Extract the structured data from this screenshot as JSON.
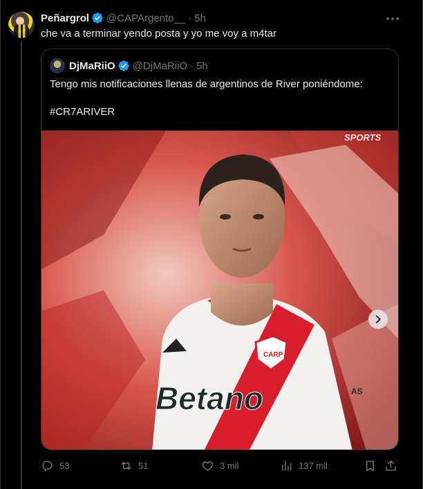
{
  "tweet": {
    "author_name": "Peñargrol",
    "handle": "@CAPArgento__",
    "separator": "·",
    "time": "5h",
    "text": "che va a terminar yendo posta y yo me voy a m4tar"
  },
  "quote": {
    "author_name": "DjMaRiiO",
    "handle": "@DjMaRiiO",
    "separator": "·",
    "time": "5h",
    "text": "Tengo mis notificaciones llenas de argentinos de River poniéndome:",
    "hashtag": "#CR7ARIVER",
    "image": {
      "watermark": "SPORTS",
      "sponsor": "Betano",
      "shirt_logo_text": "CARP",
      "sleeve_text": "AS"
    }
  },
  "actions": {
    "replies": "53",
    "reposts": "51",
    "likes": "3 mil",
    "views": "137 mil"
  },
  "colors": {
    "background": "#000000",
    "text": "#e7e9ea",
    "muted": "#71767b",
    "verified": "#1d9bf0",
    "river_red": "#d81e2c"
  }
}
